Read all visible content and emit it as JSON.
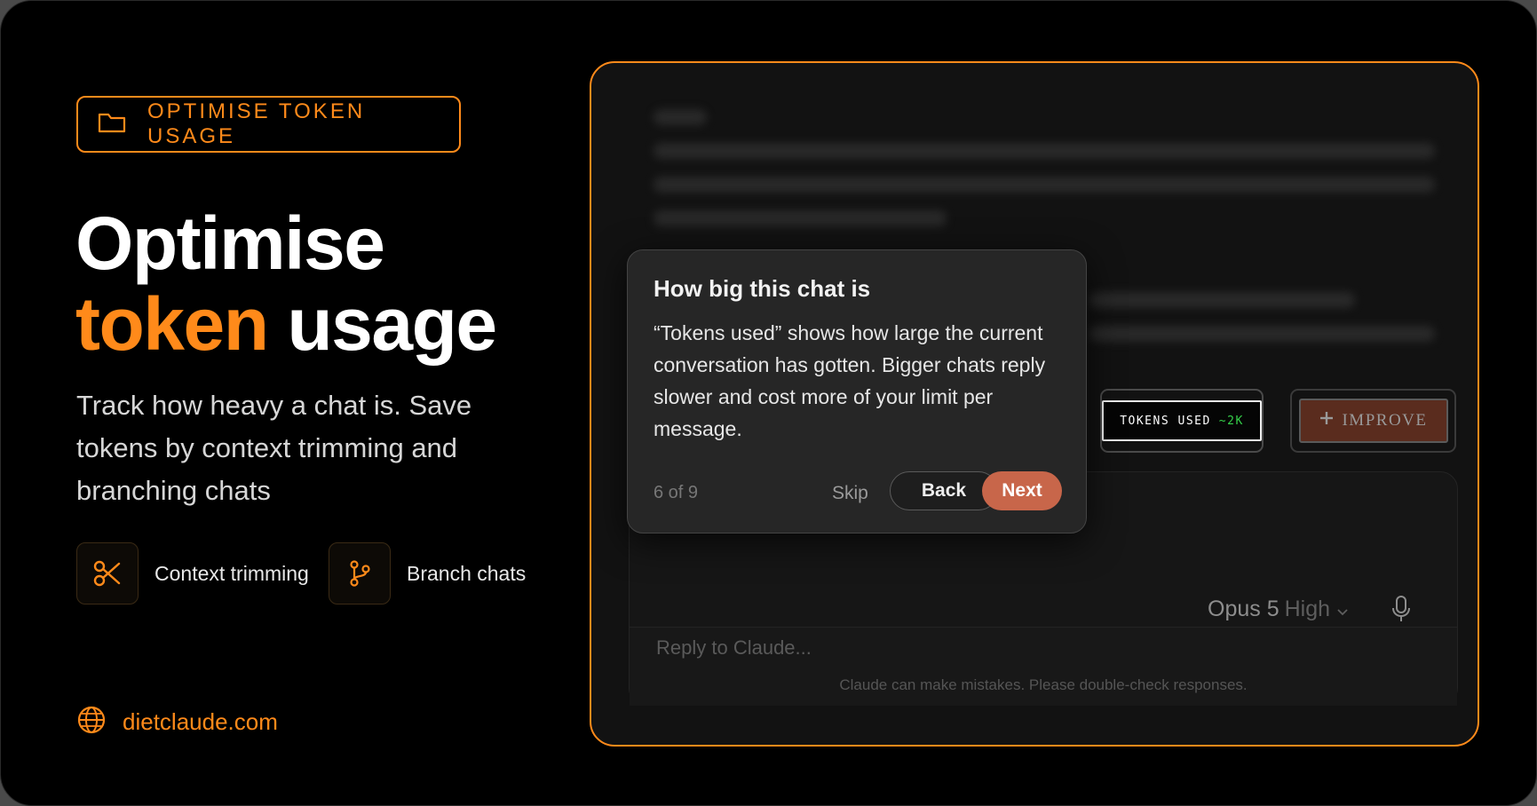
{
  "promo": {
    "tag": "OPTIMISE TOKEN USAGE",
    "headline_line1": "Optimise",
    "headline_highlight": "token",
    "headline_rest": "usage",
    "subtitle": "Track how heavy a chat is. Save tokens by context trimming and branching chats",
    "features": [
      {
        "label": "Context trimming",
        "icon": "scissors-icon"
      },
      {
        "label": "Branch chats",
        "icon": "branch-icon"
      }
    ],
    "site": "dietclaude.com",
    "site_icon": "globe-icon"
  },
  "colors": {
    "accent": "#ff8a1a",
    "next_button": "#c8664a",
    "tokens_value": "#35d04a",
    "improve_chip": "#5a2c1e"
  },
  "chat": {
    "tokens_label": "TOKENS USED",
    "tokens_value": "~2K",
    "improve_label": "IMPROVE",
    "improve_icon": "plus-icon",
    "model": "Opus 5",
    "effort": "High",
    "mic_icon": "microphone-icon",
    "reply_placeholder": "Reply to Claude...",
    "disclaimer": "Claude can make mistakes. Please double-check responses."
  },
  "tooltip": {
    "title": "How big this chat is",
    "body": "“Tokens used” shows how large the current conversation has gotten. Bigger chats reply slower and cost more of your limit per message.",
    "step": "6 of 9",
    "skip": "Skip",
    "back": "Back",
    "next": "Next"
  }
}
